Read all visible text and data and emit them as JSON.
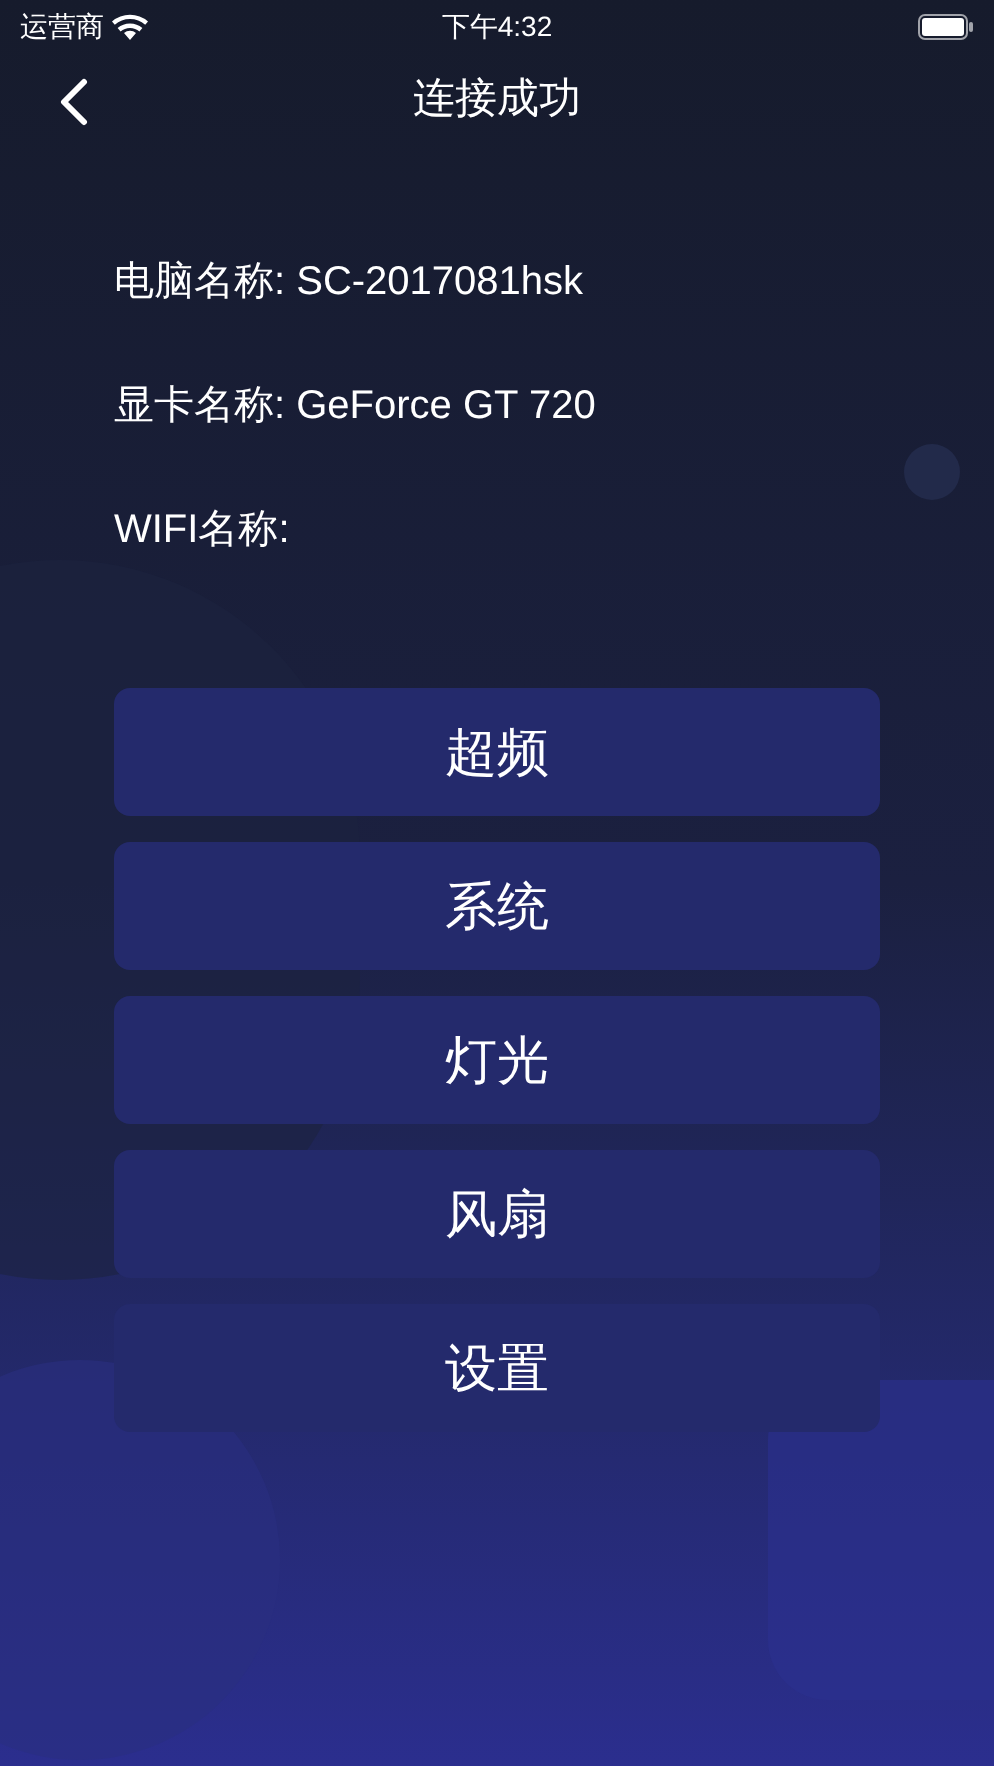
{
  "status_bar": {
    "carrier": "运营商",
    "time": "下午4:32"
  },
  "nav": {
    "title": "连接成功"
  },
  "info": [
    {
      "label": "电脑名称:",
      "value": "SC-2017081hsk"
    },
    {
      "label": "显卡名称:",
      "value": "GeForce GT 720"
    },
    {
      "label": "WIFI名称:"
    }
  ],
  "buttons": [
    "超频",
    "系统",
    "灯光",
    "风扇",
    "设置"
  ]
}
